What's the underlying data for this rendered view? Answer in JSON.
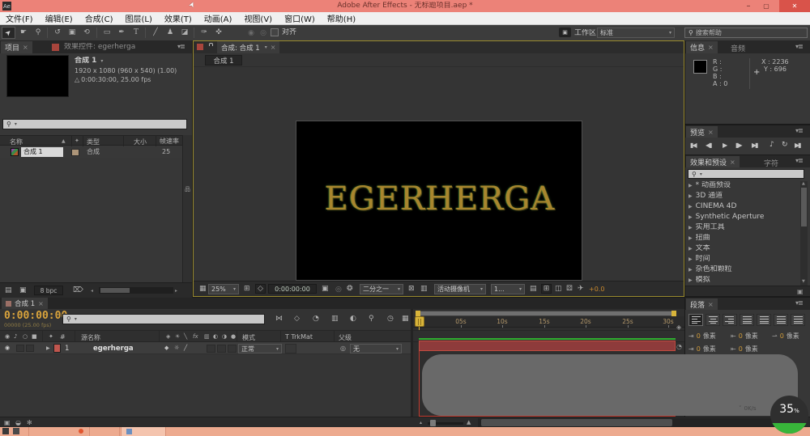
{
  "titlebar": {
    "app_initials": "Ae",
    "title": "Adobe After Effects - 无标题项目.aep *"
  },
  "menus": [
    "文件(F)",
    "编辑(E)",
    "合成(C)",
    "图层(L)",
    "效果(T)",
    "动画(A)",
    "视图(V)",
    "窗口(W)",
    "帮助(H)"
  ],
  "toolbar": {
    "snap": "对齐",
    "workspace_label": "工作区:",
    "workspace": "标准",
    "help_search": "搜索帮助"
  },
  "tool_glyphs": [
    "➤",
    "☛",
    "⚲",
    "↺",
    "▣",
    "⟲",
    "▭",
    "✒",
    "T",
    "╱",
    "♟",
    "◪",
    "✑",
    "✜"
  ],
  "tool_dim": [
    "◉",
    "◎"
  ],
  "project": {
    "tab": "项目",
    "tab_fx": "效果控件: egerherga",
    "comp_title": "合成 1",
    "meta1": "1920 x 1080  (960 x 540) (1.00)",
    "meta2": "0:00:30:00, 25.00 fps",
    "col_name": "名称",
    "col_type": "类型",
    "col_size": "大小",
    "col_fps": "帧速率",
    "row_name": "合成 1",
    "row_type": "合成",
    "row_fps": "25",
    "bpc": "8 bpc"
  },
  "comp": {
    "tab": "合成: 合成 1",
    "crumb": "合成 1",
    "canvas_text": "EGERHERGA",
    "zoom": "25%",
    "tc": "0:00:00:00",
    "res": "二分之一",
    "camera": "活动摄像机",
    "views": "1...",
    "exposure": "+0.0"
  },
  "comp_icons": [
    "▦",
    "⊞",
    "◇",
    "▣",
    "◎",
    "❂",
    "⊠",
    "▥",
    "▤",
    "⊞",
    "◫",
    "⚄",
    "✈"
  ],
  "info": {
    "tab": "信息",
    "tab2": "音频",
    "r": "R :",
    "g": "G :",
    "b": "B :",
    "a": "A : 0",
    "x": "X : 2236",
    "y": "Y : 696"
  },
  "preview": {
    "tab": "预览"
  },
  "preview_buttons": [
    "▮◀",
    "◀▮",
    "▶",
    "▮▶",
    "▶▮",
    "♪",
    "↻",
    "▶▮"
  ],
  "fx": {
    "tab": "效果和预设",
    "tab2": "字符",
    "items": [
      "* 动画预设",
      "3D 通道",
      "CINEMA 4D",
      "Synthetic Aperture",
      "实用工具",
      "扭曲",
      "文本",
      "时间",
      "杂色和颗粒",
      "模拟"
    ]
  },
  "para": {
    "tab": "段落",
    "unit": "像素",
    "v": "0"
  },
  "para_icons": [
    "⇥",
    "⇤",
    "⇀",
    "⇥",
    "⇤"
  ],
  "tl": {
    "tab": "合成 1",
    "tc": "0:00:00:00",
    "frames": "00000 (25.00 fps)",
    "src": "源名称",
    "mode_h": "模式",
    "trkmat": "T TrkMat",
    "parent_h": "父级",
    "num": "1",
    "layer": "egerherga",
    "mode": "正常",
    "parent": "无",
    "ticks": [
      "0s",
      "05s",
      "10s",
      "15s",
      "20s",
      "25s",
      "30s"
    ]
  },
  "tl_buttons": [
    "⋈",
    "◇",
    "◔",
    "▥",
    "◐",
    "⚲",
    "◷",
    "▦"
  ],
  "tl_avicons": [
    "◉",
    "♪",
    "○",
    "■"
  ],
  "tl_switches": [
    "◈",
    "☀",
    "╲",
    "fx",
    "▥",
    "◐",
    "◑",
    "●"
  ],
  "tl_lswitches": [
    "◆",
    "☼",
    "╱"
  ],
  "tl_bottom_icons": [
    "▣",
    "◒",
    "✻"
  ],
  "proj_bottom_icons": [
    "▤",
    "▣",
    "⌦"
  ],
  "icons": {
    "search": "⚲",
    "caret": "▾",
    "panel_menu": "▾≣",
    "tab_close": "×",
    "sort_asc": "▲",
    "tag": "✦",
    "duration": "△",
    "expand": "▶",
    "window_min": "–",
    "window_max": "▢",
    "window_close": "✕",
    "parent_pickwhip": "◎",
    "flowchart": "品",
    "snap_check": "",
    "workspace_badge": "▣"
  },
  "status": {
    "pct": "35",
    "unit": "%",
    "speed": "0K/s"
  },
  "colors": {
    "titlebar": "#ec8278",
    "taskbar": "#edaa8f",
    "accent_gold": "#d8b43a",
    "timecode_orange": "#d9a33c",
    "layer_red": "#8e3b3b",
    "render_green": "#2fae2f",
    "badge_green": "#38b53a",
    "title_gold": "#a8862e"
  }
}
